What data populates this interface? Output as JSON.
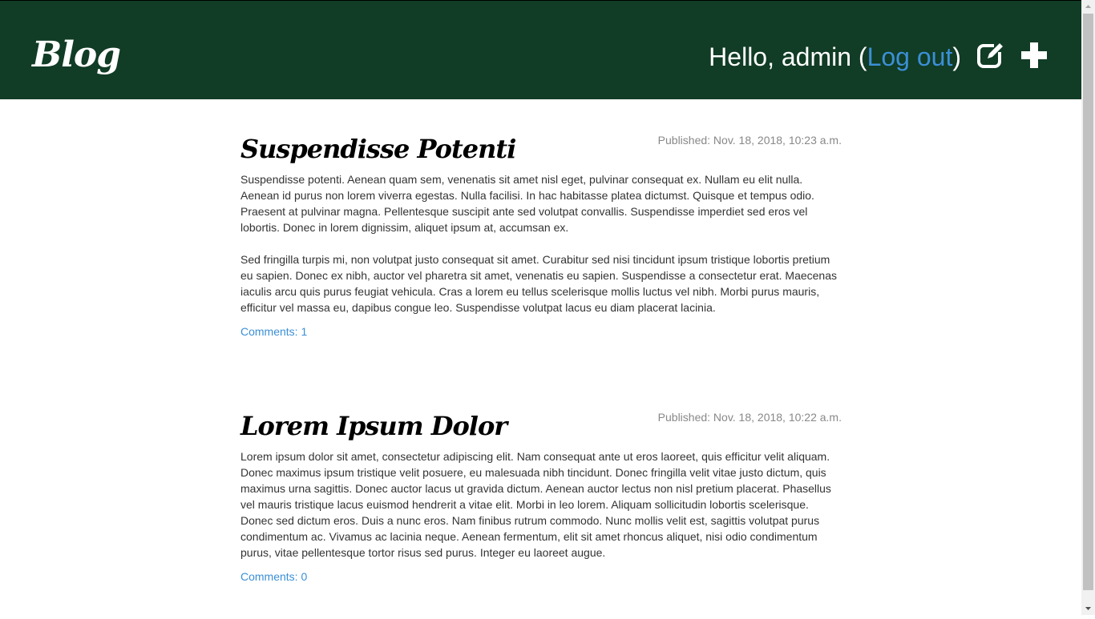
{
  "header": {
    "brand": "Blog",
    "greeting_prefix": "Hello, admin (",
    "logout_label": "Log out",
    "greeting_suffix": ")",
    "icons": [
      "edit-icon",
      "plus-icon"
    ],
    "background_color": "#113c25",
    "link_color": "#3b8fd6"
  },
  "posts": [
    {
      "title": "Suspendisse Potenti",
      "published": "Published: Nov. 18, 2018, 10:23 a.m.",
      "paragraphs": [
        "Suspendisse potenti. Aenean quam sem, venenatis sit amet nisl eget, pulvinar consequat ex. Nullam eu elit nulla. Aenean id purus non lorem viverra egestas. Nulla facilisi. In hac habitasse platea dictumst. Quisque et tempus odio. Praesent at pulvinar magna. Pellentesque suscipit ante sed volutpat convallis. Suspendisse imperdiet sed eros vel lobortis. Donec in lorem dignissim, aliquet ipsum at, accumsan ex.",
        "Sed fringilla turpis mi, non volutpat justo consequat sit amet. Curabitur sed nisi tincidunt ipsum tristique lobortis pretium eu sapien. Donec ex nibh, auctor vel pharetra sit amet, venenatis eu sapien. Suspendisse a consectetur erat. Maecenas iaculis arcu quis purus feugiat vehicula. Cras a lorem eu tellus scelerisque mollis luctus vel nibh. Morbi purus mauris, efficitur vel massa eu, dapibus congue leo. Suspendisse volutpat lacus eu diam placerat lacinia."
      ],
      "comments": "Comments: 1"
    },
    {
      "title": "Lorem Ipsum Dolor",
      "published": "Published: Nov. 18, 2018, 10:22 a.m.",
      "paragraphs": [
        "Lorem ipsum dolor sit amet, consectetur adipiscing elit. Nam consequat ante ut eros laoreet, quis efficitur velit aliquam. Donec maximus ipsum tristique velit posuere, eu malesuada nibh tincidunt. Donec fringilla velit vitae justo dictum, quis maximus urna sagittis. Donec auctor lacus ut gravida dictum. Aenean auctor lectus non nisl pretium placerat. Phasellus vel mauris tristique lacus euismod hendrerit a vitae elit. Morbi in leo lorem. Aliquam sollicitudin lobortis scelerisque. Donec sed dictum eros. Duis a nunc eros. Nam finibus rutrum commodo. Nunc mollis velit est, sagittis volutpat purus condimentum ac. Vivamus ac lacinia neque. Aenean fermentum, elit sit amet rhoncus aliquet, nisi odio condimentum purus, vitae pellentesque tortor risus sed purus. Integer eu laoreet augue."
      ],
      "comments": "Comments: 0"
    }
  ]
}
